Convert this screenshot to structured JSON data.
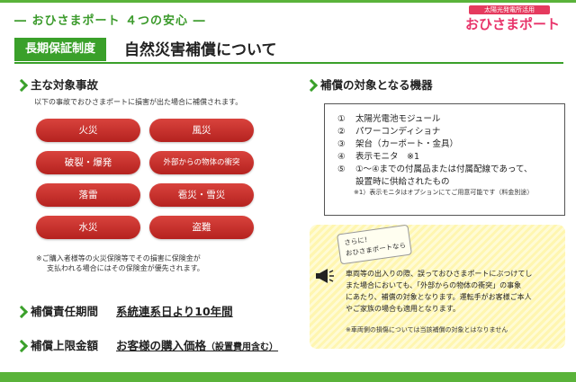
{
  "header": {
    "subtitle": "― おひさまポート ４つの安心 ―",
    "badge": "長期保証制度",
    "title": "自然災害補償について"
  },
  "logo": {
    "tagline": "太陽光発電所活用",
    "name": "おひさまポート"
  },
  "accidents": {
    "heading": "主な対象事故",
    "intro": "以下の事故でおひさまポートに損害が出た場合に補償されます。",
    "items": [
      "火災",
      "風災",
      "破裂・爆発",
      "外部からの物体の衝突",
      "落雷",
      "雹災・雪災",
      "水災",
      "盗難"
    ],
    "note_line1": "※ご購入者様等の火災保険等でその損害に保険金が",
    "note_line2": "支払われる場合にはその保険金が優先されます。"
  },
  "equipment": {
    "heading": "補償の対象となる機器",
    "items": [
      {
        "num": "①",
        "text": "太陽光電池モジュール"
      },
      {
        "num": "②",
        "text": "パワーコンディショナ"
      },
      {
        "num": "③",
        "text": "架台（カーポート・金具）"
      },
      {
        "num": "④",
        "text": "表示モニタ　※1"
      },
      {
        "num": "⑤",
        "text": "①～④までの付属品または付属配線であって、"
      }
    ],
    "item5_cont": "設置時に供給されたもの",
    "footnote": "※1）表示モニタはオプションにてご用意可能です（料金別途）"
  },
  "sarani": {
    "callout_line1": "さらに！",
    "callout_line2": "おひさまポートなら",
    "lines": [
      "車両等の出入りの際、誤っておひさまポートにぶつけてし",
      "また場合においても、「外部からの物体の衝突」の事象",
      "にあたり、補償の対象となります。運転手がお客様ご本人",
      "やご家族の場合も適用となります。"
    ],
    "note": "※車両側の損傷については当該補償の対象とはなりません"
  },
  "period": {
    "heading": "補償責任期間",
    "value": "系統連系日より10年間"
  },
  "limit": {
    "heading": "補償上限金額",
    "value": "お客様の購入価格",
    "value_small": "（設置費用含む）"
  },
  "colors": {
    "green": "#3aa02a",
    "red": "#c4302b",
    "pink": "#e8336a",
    "yellow": "#fff6b0"
  }
}
